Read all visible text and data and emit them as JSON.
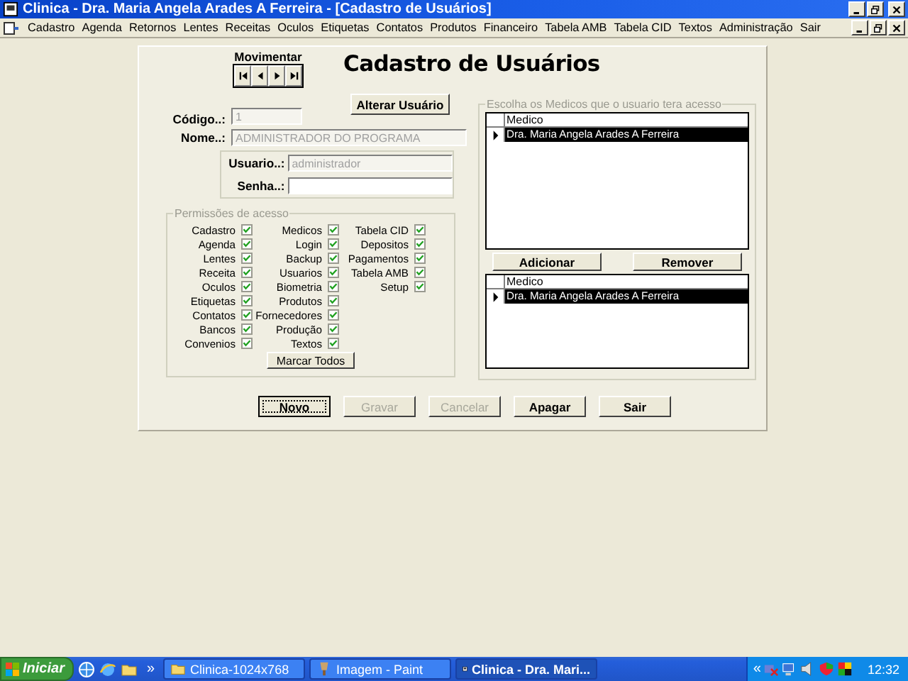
{
  "window": {
    "title": "Clinica - Dra. Maria Angela Arades A Ferreira - [Cadastro de Usuários]"
  },
  "menu": [
    "Cadastro",
    "Agenda",
    "Retornos",
    "Lentes",
    "Receitas",
    "Oculos",
    "Etiquetas",
    "Contatos",
    "Produtos",
    "Financeiro",
    "Tabela AMB",
    "Tabela CID",
    "Textos",
    "Administração",
    "Sair"
  ],
  "form": {
    "title": "Cadastro de Usuários",
    "nav_label": "Movimentar",
    "alter_button": "Alterar Usuário",
    "fields": [
      {
        "label": "Código..:",
        "value": "1",
        "disabled": true
      },
      {
        "label": "Nome..:",
        "value": "ADMINISTRADOR DO PROGRAMA",
        "disabled": true
      }
    ],
    "login_fields": [
      {
        "label": "Usuario..:",
        "value": "administrador",
        "disabled": true
      },
      {
        "label": "Senha..:",
        "disabled": false
      }
    ],
    "permissions": {
      "title": "Permissões de acesso",
      "columns": [
        [
          {
            "label": "Cadastro",
            "checked": true
          },
          {
            "label": "Agenda",
            "checked": true
          },
          {
            "label": "Lentes",
            "checked": true
          },
          {
            "label": "Receita",
            "checked": true
          },
          {
            "label": "Oculos",
            "checked": true
          },
          {
            "label": "Etiquetas",
            "checked": true
          },
          {
            "label": "Contatos",
            "checked": true
          },
          {
            "label": "Bancos",
            "checked": true
          },
          {
            "label": "Convenios",
            "checked": true
          }
        ],
        [
          {
            "label": "Medicos",
            "checked": true
          },
          {
            "label": "Login",
            "checked": true
          },
          {
            "label": "Backup",
            "checked": true
          },
          {
            "label": "Usuarios",
            "checked": true
          },
          {
            "label": "Biometria",
            "checked": true
          },
          {
            "label": "Produtos",
            "checked": true
          },
          {
            "label": "Fornecedores",
            "checked": true
          },
          {
            "label": "Produção",
            "checked": true
          },
          {
            "label": "Textos",
            "checked": true
          }
        ],
        [
          {
            "label": "Tabela CID",
            "checked": true
          },
          {
            "label": "Depositos",
            "checked": true
          },
          {
            "label": "Pagamentos",
            "checked": true
          },
          {
            "label": "Tabela AMB",
            "checked": true
          },
          {
            "label": "Setup",
            "checked": true
          }
        ]
      ],
      "button": "Marcar Todos"
    },
    "doctors": {
      "title": "Escolha os Medicos que o usuario tera acesso",
      "available": {
        "header": "Medico",
        "rows": [
          {
            "name": "Dra. Maria Angela Arades A Ferreira",
            "selected": true
          }
        ]
      },
      "buttons": [
        "Adicionar",
        "Remover"
      ],
      "chosen": {
        "header": "Medico",
        "rows": [
          {
            "name": "Dra. Maria Angela Arades A Ferreira",
            "selected": true
          }
        ]
      }
    },
    "buttons": [
      {
        "label": "Novo",
        "disabled": false,
        "focused": true
      },
      {
        "label": "Gravar",
        "disabled": true,
        "focused": false
      },
      {
        "label": "Cancelar",
        "disabled": true,
        "focused": false
      },
      {
        "label": "Apagar",
        "disabled": false,
        "focused": false
      },
      {
        "label": "Sair",
        "disabled": false,
        "focused": false
      }
    ]
  },
  "taskbar": {
    "start": "Iniciar",
    "more": "»",
    "tasks": [
      {
        "label": "Clinica-1024x768",
        "kind": "folder",
        "active": false
      },
      {
        "label": "Imagem - Paint",
        "kind": "paint",
        "active": false
      },
      {
        "label": "Clinica - Dra. Mari...",
        "kind": "app",
        "active": true
      }
    ],
    "tray_more": "«",
    "clock": "12:32"
  }
}
